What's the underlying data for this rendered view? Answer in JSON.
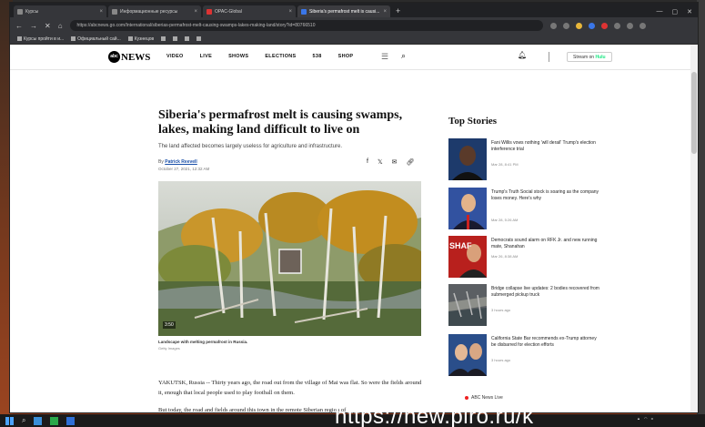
{
  "browser": {
    "tabs": [
      {
        "label": "Курсы",
        "active": false
      },
      {
        "label": "Информационные ресурсы",
        "active": false
      },
      {
        "label": "OPAC-Global",
        "active": false
      },
      {
        "label": "Siberia's permafrost melt is causi...",
        "active": true
      }
    ],
    "url": "https://abcnews.go.com/International/siberias-permafrost-melt-causing-swamps-lakes-making-land/story?id=80766510",
    "bookmarks": [
      "Курсы пройти в и...",
      "Официальный сай...",
      "Кузнецов"
    ]
  },
  "nav": {
    "logo_badge": "abc",
    "logo_word": "NEWS",
    "items": [
      "VIDEO",
      "LIVE",
      "SHOWS",
      "ELECTIONS",
      "538",
      "SHOP"
    ],
    "stream_label": "Stream on",
    "stream_brand": "Hulu"
  },
  "article": {
    "headline": "Siberia's permafrost melt is causing swamps, lakes, making land difficult to live on",
    "dek": "The land affected becomes largely useless for agriculture and infrastructure.",
    "by_prefix": "By",
    "author": "Patrick Reevell",
    "date": "October 27, 2021, 12:32 AM",
    "video_time": "3:50",
    "caption": "Landscape with melting permafrost in Russia.",
    "credit": "Getty Images",
    "para1": "YAKUTSK, Russia -- Thirty years ago, the road out from the village of Mai was flat. So were the fields around it, enough that local people used to play football on them.",
    "para2": "But today, the road and fields around this town in the remote Siberian region of"
  },
  "top_stories": {
    "title": "Top Stories",
    "items": [
      {
        "title": "Fani Willis vows nothing 'will derail' Trump's election interference trial",
        "meta": "Mar 28, 8:41 PM"
      },
      {
        "title": "Trump's Truth Social stock is soaring as the company loses money. Here's why",
        "meta": "Mar 28, 5:26 AM"
      },
      {
        "title": "Democrats sound alarm on RFK Jr. and new running mate, Shanahan",
        "meta": "Mar 26, 8:38 AM"
      },
      {
        "title": "Bridge collapse live updates: 2 bodies recovered from submerged pickup truck",
        "meta": "3 hours ago"
      },
      {
        "title": "California State Bar recommends ex-Trump attorney be disbarred for election efforts",
        "meta": "3 hours ago"
      }
    ],
    "thumb_label": "SHAF"
  },
  "live_label": "ABC News Live",
  "watermark": "https://new.plro.ru/k"
}
